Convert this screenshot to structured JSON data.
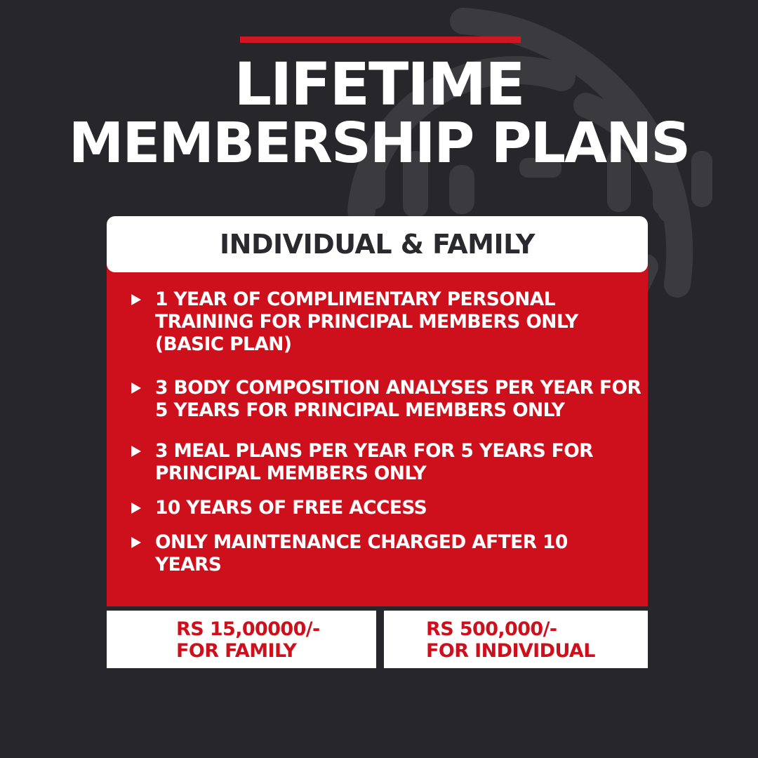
{
  "headline": {
    "line1": "LIFETIME",
    "line2": "MEMBERSHIP PLANS"
  },
  "card": {
    "title": "INDIVIDUAL & FAMILY",
    "benefits": [
      {
        "text": "1 YEAR OF COMPLIMENTARY PERSONAL TRAINING FOR PRINCIPAL MEMBERS ONLY (BASIC PLAN)"
      },
      {
        "text": "3 BODY COMPOSITION ANALYSES PER YEAR FOR 5 YEARS FOR PRINCIPAL MEMBERS ONLY"
      },
      {
        "text": "3 MEAL PLANS PER YEAR FOR 5 YEARS FOR PRINCIPAL MEMBERS ONLY"
      },
      {
        "text": "10 YEARS OF FREE ACCESS"
      },
      {
        "text": "ONLY MAINTENANCE CHARGED AFTER 10 YEARS"
      }
    ]
  },
  "prices": {
    "family": {
      "amount": "RS 15,00000/-",
      "label": "FOR FAMILY"
    },
    "individual": {
      "amount": "RS 500,000/-",
      "label": "FOR INDIVIDUAL"
    }
  },
  "colors": {
    "background": "#27272b",
    "accent_red": "#ce0f1c",
    "text_white": "#ffffff",
    "text_dark": "#2a2a2e"
  },
  "icons": {
    "bullet": "triangle-bullet-icon",
    "watermark": "brand-logo-watermark"
  }
}
